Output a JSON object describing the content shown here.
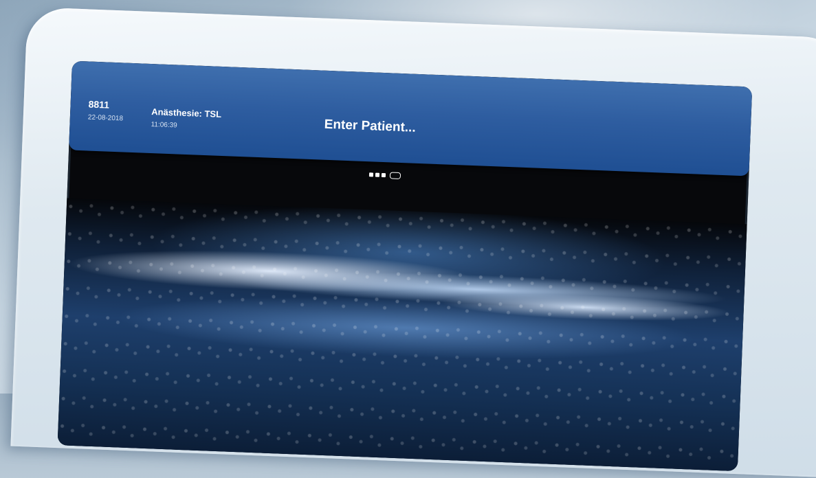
{
  "header": {
    "patient_id": "8811",
    "date": "22-08-2018",
    "procedure": "Anästhesie: TSL",
    "time": "11:06:39",
    "title": "Enter Patient..."
  },
  "pager": {
    "current_page": 4,
    "total_pages": 4
  },
  "colors": {
    "header_bar": "#2e5da0",
    "frame": "#dfe9f0",
    "screen": "#07080b"
  },
  "icons": {
    "pager": "page-indicator-dots"
  }
}
